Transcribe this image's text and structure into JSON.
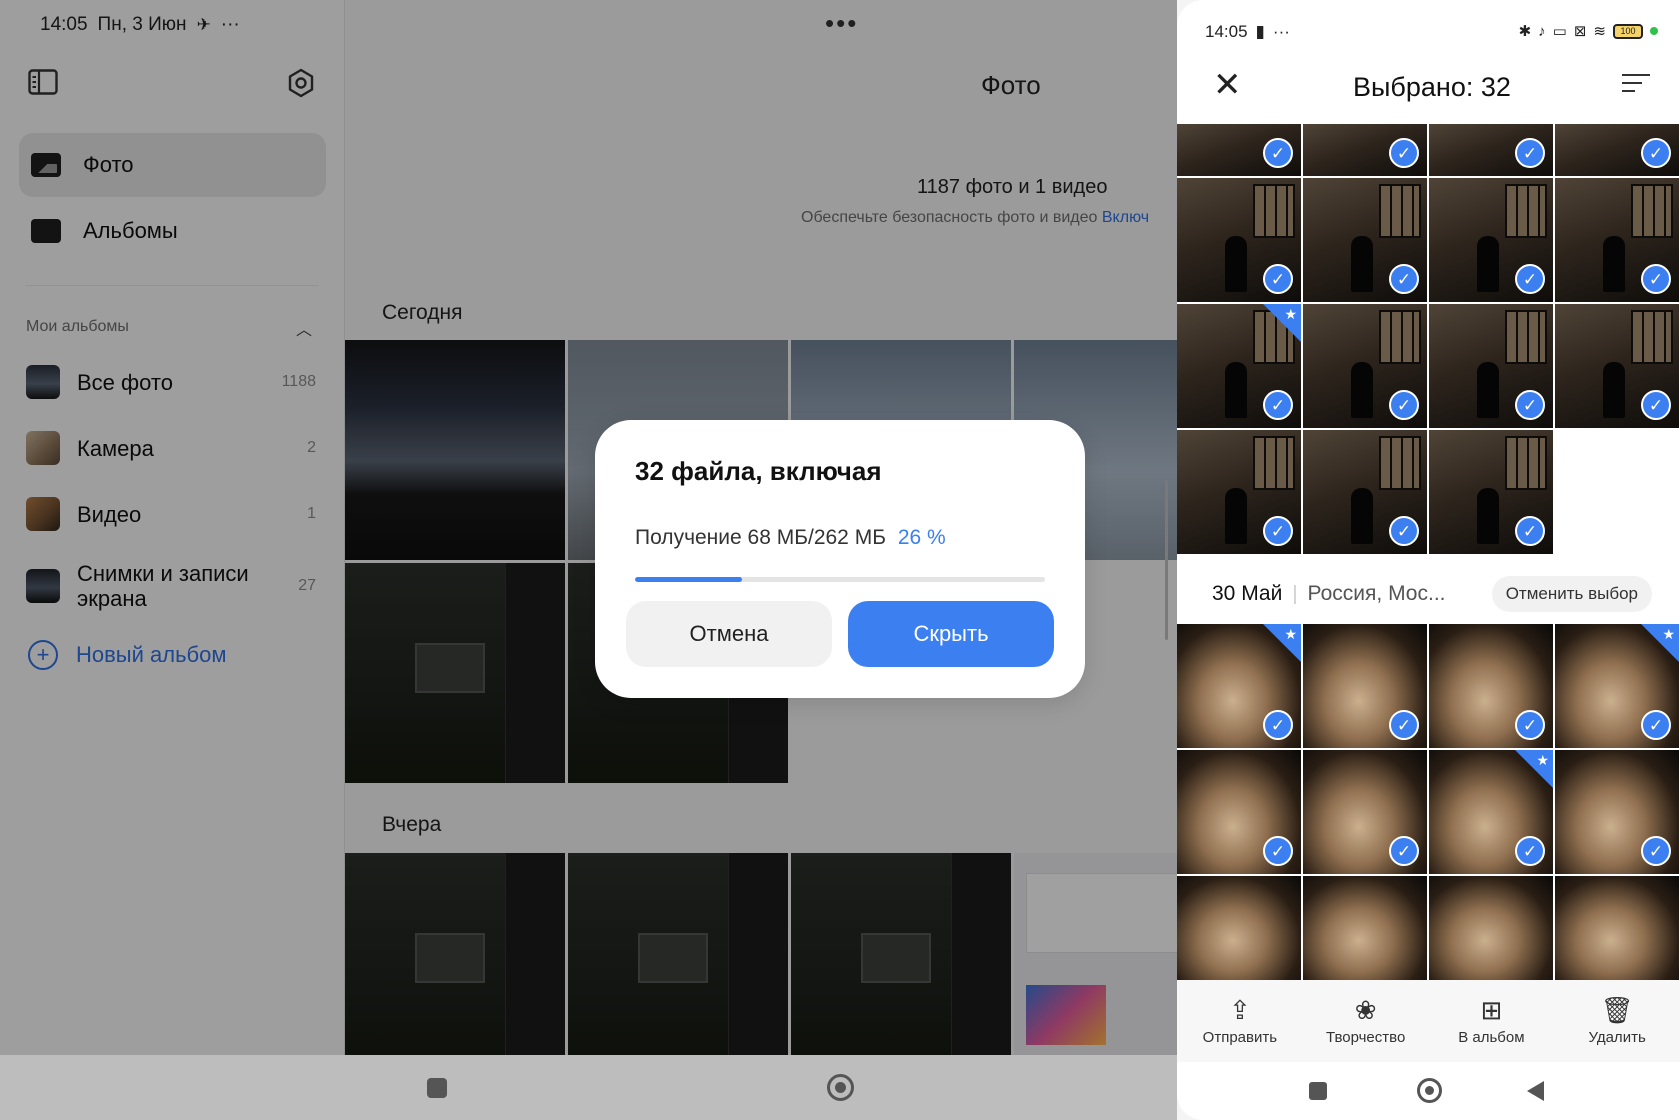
{
  "status_left": {
    "time": "14:05",
    "date": "Пн, 3 Июн",
    "more": "···"
  },
  "sidebar": {
    "nav": [
      {
        "label": "Фото",
        "active": true
      },
      {
        "label": "Альбомы",
        "active": false
      }
    ],
    "section_title": "Мои альбомы",
    "albums": [
      {
        "name": "Все фото",
        "count": "1188"
      },
      {
        "name": "Камера",
        "count": "2"
      },
      {
        "name": "Видео",
        "count": "1"
      },
      {
        "name": "Снимки и записи экрана",
        "count": "27"
      }
    ],
    "new_album": "Новый альбом"
  },
  "main": {
    "dots": "•••",
    "title": "Фото",
    "summary": "1187 фото и 1 видео",
    "secure_text": "Обеспечьте безопасность фото и видео",
    "secure_link": "Включ",
    "sections": [
      "Сегодня",
      "Вчера"
    ]
  },
  "dialog": {
    "title": "32 файла, включая",
    "status": "Получение 68 МБ/262 МБ",
    "percent": "26 %",
    "progress": 0.26,
    "cancel": "Отмена",
    "hide": "Скрыть"
  },
  "phone": {
    "time": "14:05",
    "more": "···",
    "battery": "100",
    "title": "Выбрано: 32",
    "date": "30 Май",
    "place": "Россия, Мос...",
    "deselect": "Отменить выбор",
    "actions": [
      {
        "label": "Отправить",
        "icon": "share-icon"
      },
      {
        "label": "Творчество",
        "icon": "creative-icon"
      },
      {
        "label": "В альбом",
        "icon": "add-to-album-icon"
      },
      {
        "label": "Удалить",
        "icon": "trash-icon"
      }
    ]
  },
  "colors": {
    "accent": "#3b7ff0",
    "link": "#2f6fe0"
  }
}
